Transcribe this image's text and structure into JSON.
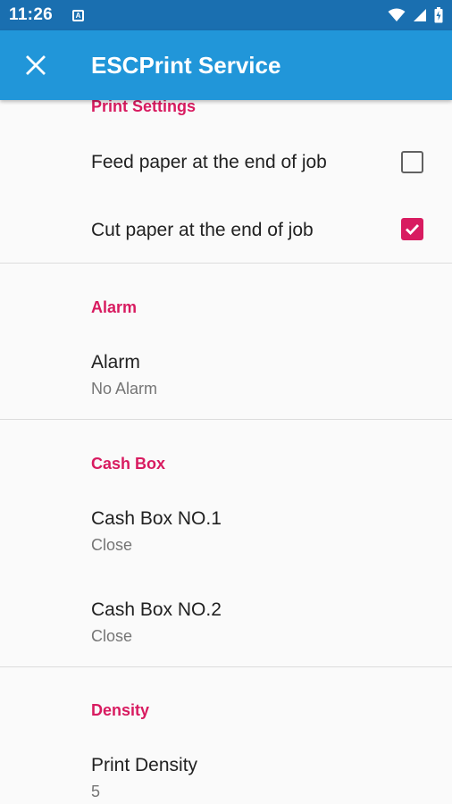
{
  "status_bar": {
    "time": "11:26",
    "notif_letter": "A"
  },
  "app_bar": {
    "title": "ESCPrint Service"
  },
  "sections": {
    "print_settings": {
      "header": "Print Settings",
      "feed_paper": {
        "label": "Feed paper at the end of job",
        "checked": false
      },
      "cut_paper": {
        "label": "Cut paper at the end of job",
        "checked": true
      }
    },
    "alarm": {
      "header": "Alarm",
      "alarm": {
        "title": "Alarm",
        "summary": "No Alarm"
      }
    },
    "cash_box": {
      "header": "Cash Box",
      "box1": {
        "title": "Cash Box NO.1",
        "summary": "Close"
      },
      "box2": {
        "title": "Cash Box NO.2",
        "summary": "Close"
      }
    },
    "density": {
      "header": "Density",
      "print_density": {
        "title": "Print Density",
        "summary": "5"
      }
    }
  },
  "colors": {
    "status_bar": "#1a6fb0",
    "app_bar": "#2196d9",
    "accent": "#d81b60"
  }
}
